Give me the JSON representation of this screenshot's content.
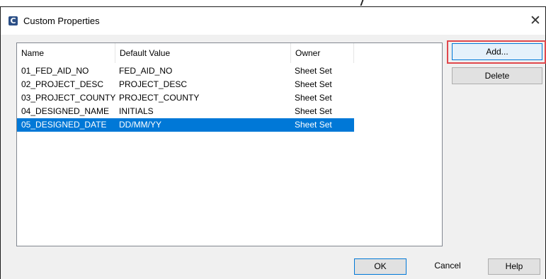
{
  "window": {
    "title": "Custom Properties",
    "close_glyph": "✕",
    "app_icon_letter": "C"
  },
  "table": {
    "columns": [
      "Name",
      "Default Value",
      "Owner"
    ],
    "rows": [
      {
        "name": "01_FED_AID_NO",
        "default": "FED_AID_NO",
        "owner": "Sheet Set"
      },
      {
        "name": "02_PROJECT_DESC",
        "default": "PROJECT_DESC",
        "owner": "Sheet Set"
      },
      {
        "name": "03_PROJECT_COUNTY",
        "default": "PROJECT_COUNTY",
        "owner": "Sheet Set"
      },
      {
        "name": "04_DESIGNED_NAME",
        "default": "INITIALS",
        "owner": "Sheet Set"
      },
      {
        "name": "05_DESIGNED_DATE",
        "default": "DD/MM/YY",
        "owner": "Sheet Set"
      }
    ],
    "selected_index": 4
  },
  "buttons": {
    "add": "Add...",
    "delete": "Delete",
    "ok": "OK",
    "cancel": "Cancel",
    "help": "Help"
  },
  "colors": {
    "selection": "#0078d7",
    "highlight": "#e0474c",
    "app_icon": "#2b4f86"
  }
}
